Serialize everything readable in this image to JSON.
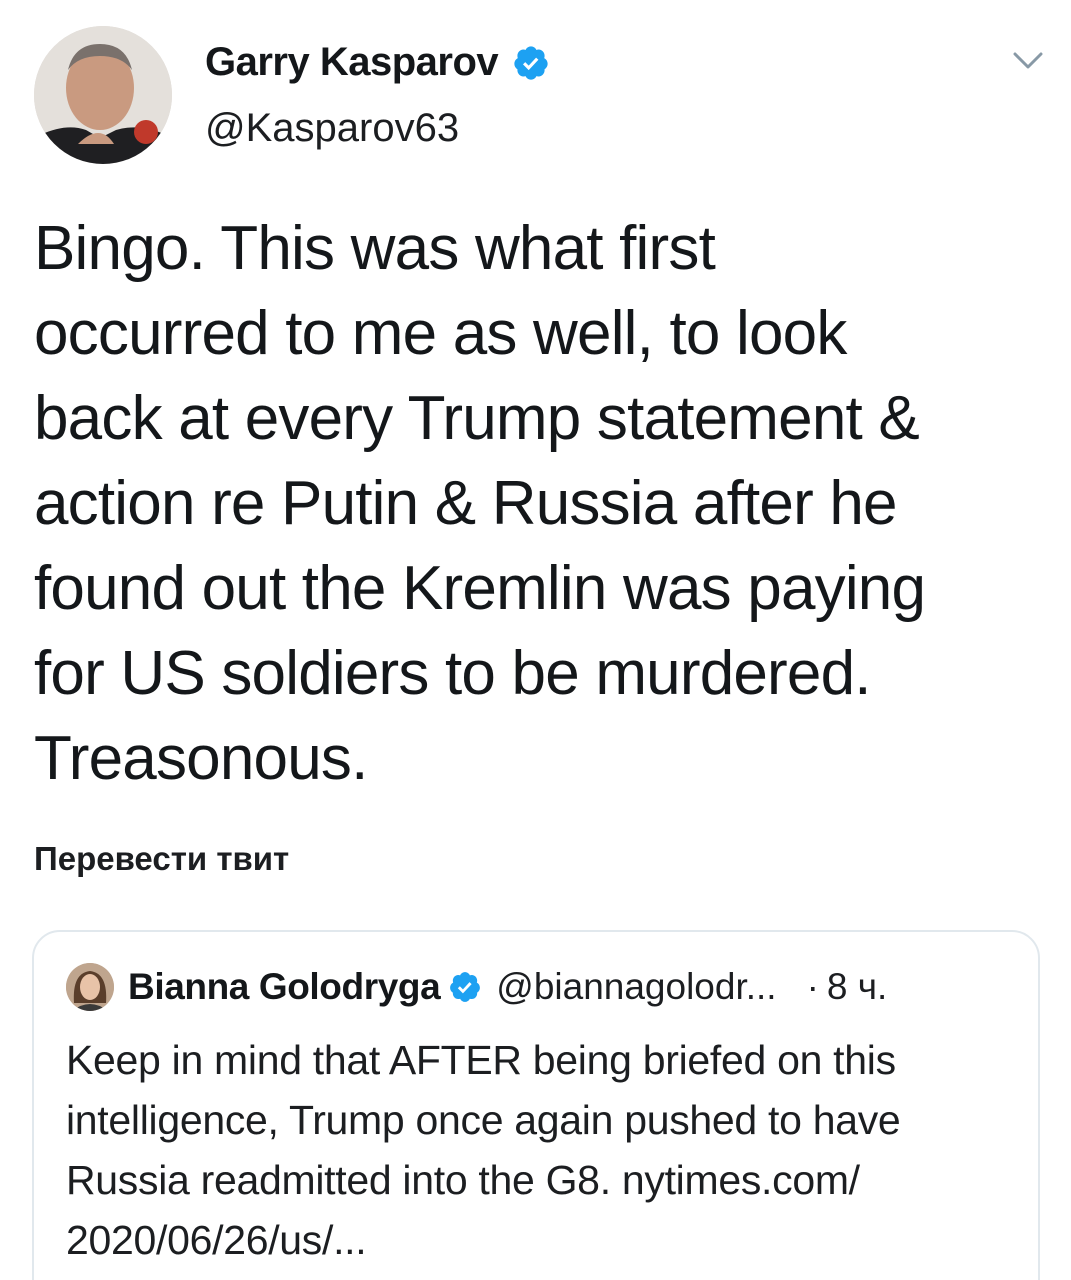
{
  "tweet": {
    "author": {
      "name": "Garry Kasparov",
      "handle": "@Kasparov63",
      "verified": true,
      "avatar_badge": "RDI"
    },
    "text": "Bingo. This was what first\noccurred to me as well, to look\nback at every Trump statement &\naction re Putin & Russia after he\nfound out the Kremlin was paying\nfor US soldiers to be murdered.\nTreasonous.",
    "translate_label": "Перевести твит",
    "menu_icon": "chevron-down-icon"
  },
  "quote": {
    "author": {
      "name": "Bianna Golodryga",
      "handle": "@biannagolodr...",
      "verified": true
    },
    "separator": "·",
    "time": "8 ч.",
    "text": "Keep in mind that AFTER being briefed on this\nintelligence, Trump once again pushed to have\nRussia readmitted into the G8. nytimes.com/\n2020/06/26/us/..."
  },
  "colors": {
    "verified_blue": "#1da1f2",
    "text": "#14171a",
    "border": "#e1e8ed",
    "chevron": "#8899a6"
  }
}
